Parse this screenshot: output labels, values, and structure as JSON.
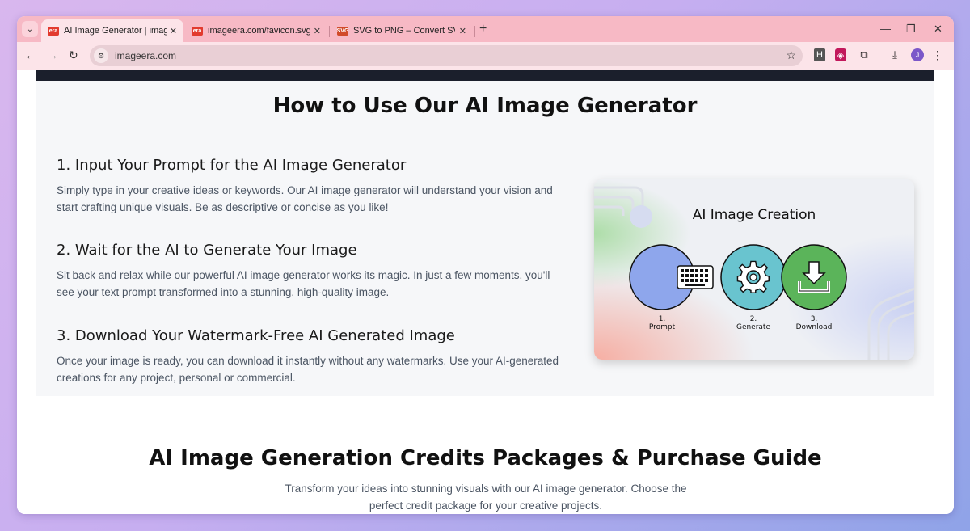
{
  "browser": {
    "tabs": [
      {
        "favicon_text": "era",
        "favicon_color": "#e23a2e",
        "title": "AI Image Generator | imageera",
        "active": true
      },
      {
        "favicon_text": "era",
        "favicon_color": "#e23a2e",
        "title": "imageera.com/favicon.svg",
        "active": false
      },
      {
        "favicon_text": "SVG",
        "favicon_color": "#d14a2a",
        "title": "SVG to PNG – Convert SVG files",
        "active": false
      }
    ],
    "address": "imageera.com",
    "extension_h": "H"
  },
  "howto": {
    "title": "How to Use Our AI Image Generator",
    "steps": [
      {
        "heading": "1. Input Your Prompt for the AI Image Generator",
        "text": "Simply type in your creative ideas or keywords. Our AI image generator will understand your vision and start crafting unique visuals. Be as descriptive or concise as you like!"
      },
      {
        "heading": "2. Wait for the AI to Generate Your Image",
        "text": "Sit back and relax while our powerful AI image generator works its magic. In just a few moments, you'll see your text prompt transformed into a stunning, high-quality image."
      },
      {
        "heading": "3. Download Your Watermark-Free AI Generated Image",
        "text": "Once your image is ready, you can download it instantly without any watermarks. Use your AI-generated creations for any project, personal or commercial."
      }
    ]
  },
  "illustration": {
    "title": "AI Image Creation",
    "circles": [
      {
        "number": "1.",
        "label": "Prompt",
        "color": "#8ea6ec",
        "icon": "keyboard-icon"
      },
      {
        "number": "2.",
        "label": "Generate",
        "color": "#69c4cf",
        "icon": "gear-icon"
      },
      {
        "number": "3.",
        "label": "Download",
        "color": "#5bb45a",
        "icon": "download-icon"
      }
    ]
  },
  "credits": {
    "title": "AI Image Generation Credits Packages & Purchase Guide",
    "subtitle": "Transform your ideas into stunning visuals with our AI image generator. Choose the perfect credit package for your creative projects."
  },
  "colors": {
    "tabstrip": "#f7b9c5",
    "toolbar": "#fce4e9",
    "dark_bar": "#1b1f2c"
  }
}
